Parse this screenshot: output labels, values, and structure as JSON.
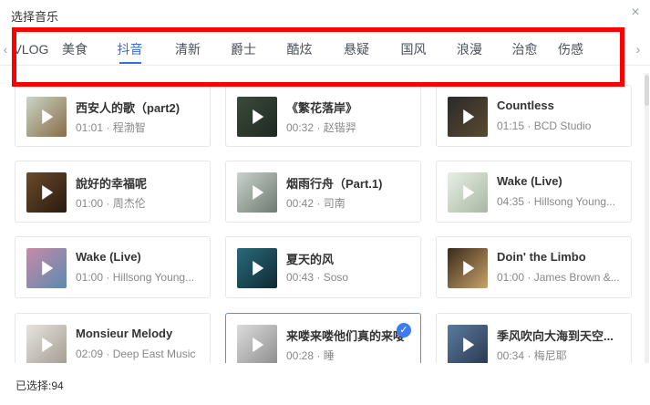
{
  "dialog": {
    "title": "选择音乐",
    "close_glyph": "×"
  },
  "nav": {
    "left_arrow": "‹",
    "right_arrow": "›"
  },
  "tabs": [
    {
      "label": "VLOG",
      "active": false
    },
    {
      "label": "美食",
      "active": false
    },
    {
      "label": "抖音",
      "active": true
    },
    {
      "label": "清新",
      "active": false
    },
    {
      "label": "爵士",
      "active": false
    },
    {
      "label": "酷炫",
      "active": false
    },
    {
      "label": "悬疑",
      "active": false
    },
    {
      "label": "国风",
      "active": false
    },
    {
      "label": "浪漫",
      "active": false
    },
    {
      "label": "治愈",
      "active": false
    },
    {
      "label": "伤感",
      "active": false
    }
  ],
  "songs": [
    {
      "title": "西安人的歌（part2)",
      "meta": "01:01 · 程渤智",
      "cover": [
        "#c8d6c3",
        "#8a6b4a"
      ],
      "selected": false
    },
    {
      "title": "《繁花落岸》",
      "meta": "00:32 · 赵锴羿",
      "cover": [
        "#3a4a3c",
        "#1f2a22"
      ],
      "selected": false
    },
    {
      "title": "Countless",
      "meta": "01:15 · BCD Studio",
      "cover": [
        "#2a2a2a",
        "#5a4a30"
      ],
      "selected": false
    },
    {
      "title": "說好的幸福呢",
      "meta": "01:00 · 周杰伦",
      "cover": [
        "#6a4a2a",
        "#2a1a10"
      ],
      "selected": false
    },
    {
      "title": "烟雨行舟（Part.1)",
      "meta": "00:42 · 司南",
      "cover": [
        "#c9d2cc",
        "#6e7a72"
      ],
      "selected": false
    },
    {
      "title": "Wake (Live)",
      "meta": "04:35 · Hillsong Young...",
      "cover": [
        "#e8efe6",
        "#a8b8a0"
      ],
      "selected": false
    },
    {
      "title": "Wake (Live)",
      "meta": "01:00 · Hillsong Young...",
      "cover": [
        "#c98aa8",
        "#5a8ab0"
      ],
      "selected": false
    },
    {
      "title": "夏天的风",
      "meta": "00:43 · Soso",
      "cover": [
        "#2a6a7a",
        "#0e2a34"
      ],
      "selected": false
    },
    {
      "title": "Doin' the Limbo",
      "meta": "01:00 · James Brown &...",
      "cover": [
        "#3a2a1a",
        "#c9a36a"
      ],
      "selected": false
    },
    {
      "title": "Monsieur Melody",
      "meta": "02:09 · Deep East Music",
      "cover": [
        "#e7e4df",
        "#a39c92"
      ],
      "selected": false
    },
    {
      "title": "来喽来喽他们真的来喽",
      "meta": "00:28 · 睡",
      "cover": [
        "#dcdcdc",
        "#8e8e8e"
      ],
      "selected": true
    },
    {
      "title": "季风吹向大海到天空...",
      "meta": "00:34 · 梅尼耶",
      "cover": [
        "#5a7aa0",
        "#2a3a50"
      ],
      "selected": false
    }
  ],
  "footer": {
    "selected_label": "已选择:",
    "selected_count": "94"
  },
  "colors": {
    "accent": "#2f6fe4",
    "highlight_box": "#ff0000"
  }
}
